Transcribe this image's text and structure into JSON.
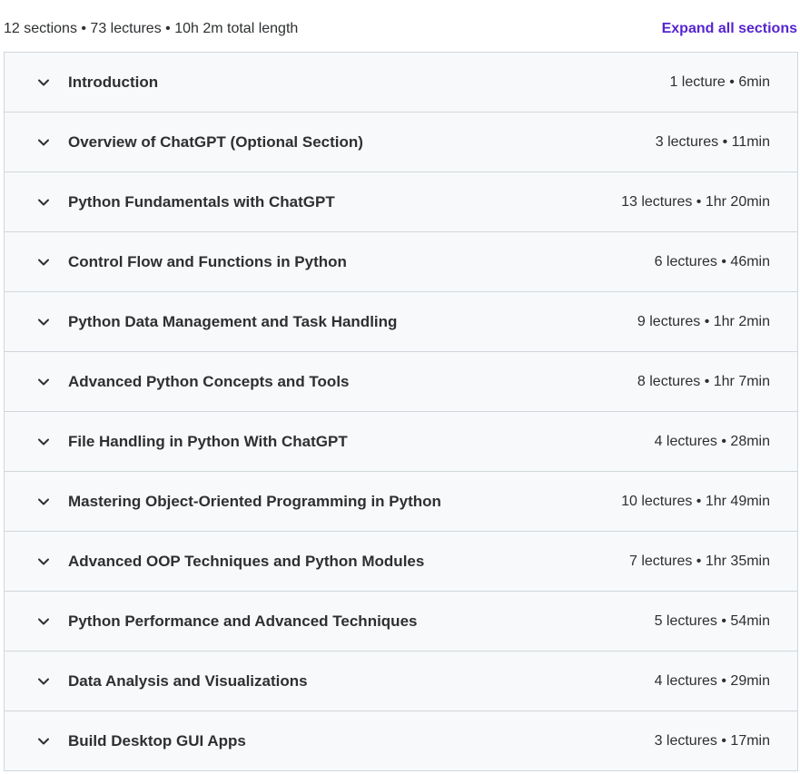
{
  "summary": {
    "text": "12 sections • 73 lectures • 10h 2m total length",
    "expand_label": "Expand all sections"
  },
  "icons": {
    "section_toggle": "chevron-down-icon"
  },
  "colors": {
    "accent": "#5624d0",
    "row_background": "#f7f9fa",
    "border": "#d1d7dc",
    "text": "#2d2f31"
  },
  "sections": [
    {
      "title": "Introduction",
      "meta": "1 lecture • 6min"
    },
    {
      "title": "Overview of ChatGPT (Optional Section)",
      "meta": "3 lectures • 11min"
    },
    {
      "title": "Python Fundamentals with ChatGPT",
      "meta": "13 lectures • 1hr 20min"
    },
    {
      "title": "Control Flow and Functions in Python",
      "meta": "6 lectures • 46min"
    },
    {
      "title": "Python Data Management and Task Handling",
      "meta": "9 lectures • 1hr 2min"
    },
    {
      "title": "Advanced Python Concepts and Tools",
      "meta": "8 lectures • 1hr 7min"
    },
    {
      "title": "File Handling in Python With ChatGPT",
      "meta": "4 lectures • 28min"
    },
    {
      "title": "Mastering Object-Oriented Programming in Python",
      "meta": "10 lectures • 1hr 49min"
    },
    {
      "title": "Advanced OOP Techniques and Python Modules",
      "meta": "7 lectures • 1hr 35min"
    },
    {
      "title": "Python Performance and Advanced Techniques",
      "meta": "5 lectures • 54min"
    },
    {
      "title": "Data Analysis and Visualizations",
      "meta": "4 lectures • 29min"
    },
    {
      "title": "Build Desktop GUI Apps",
      "meta": "3 lectures • 17min"
    }
  ]
}
